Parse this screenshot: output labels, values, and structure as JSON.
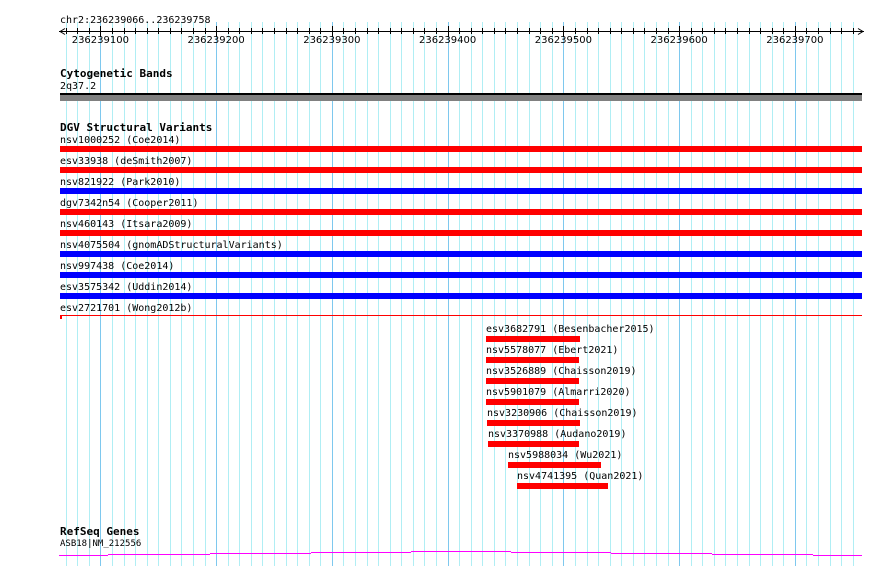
{
  "location": "chr2:236239066..236239758",
  "view": {
    "start": 236239066,
    "end": 236239758
  },
  "ruler": {
    "labels": [
      "236239100",
      "236239200",
      "236239300",
      "236239400",
      "236239500",
      "236239600",
      "236239700"
    ]
  },
  "tracks": {
    "cytoband": {
      "title": "Cytogenetic Bands",
      "band": "2q37.2",
      "color": "#808080"
    },
    "dgv": {
      "title": "DGV Structural Variants",
      "full_features": [
        {
          "label": "nsv1000252 (Coe2014)",
          "color": "#ff0000"
        },
        {
          "label": "esv33938 (deSmith2007)",
          "color": "#ff0000"
        },
        {
          "label": "nsv821922 (Park2010)",
          "color": "#0000ff"
        },
        {
          "label": "dgv7342n54 (Cooper2011)",
          "color": "#ff0000"
        },
        {
          "label": "nsv460143 (Itsara2009)",
          "color": "#ff0000"
        },
        {
          "label": "nsv4075504 (gnomADStructuralVariants)",
          "color": "#0000ff"
        },
        {
          "label": "nsv997438 (Coe2014)",
          "color": "#0000ff"
        },
        {
          "label": "esv3575342 (Uddin2014)",
          "color": "#0000ff"
        },
        {
          "label": "esv2721701 (Wong2012b)",
          "color": "#ff0000"
        }
      ],
      "local_features": [
        {
          "label": "esv3682791 (Besenbacher2015)",
          "start": 236239433,
          "end": 236239514,
          "color": "#ff0000"
        },
        {
          "label": "nsv5578077 (Ebert2021)",
          "start": 236239433,
          "end": 236239513,
          "color": "#ff0000"
        },
        {
          "label": "nsv3526889 (Chaisson2019)",
          "start": 236239433,
          "end": 236239513,
          "color": "#ff0000"
        },
        {
          "label": "nsv5901079 (Almarri2020)",
          "start": 236239433,
          "end": 236239513,
          "color": "#ff0000"
        },
        {
          "label": "nsv3230906 (Chaisson2019)",
          "start": 236239434,
          "end": 236239514,
          "color": "#ff0000"
        },
        {
          "label": "nsv3370988 (Audano2019)",
          "start": 236239435,
          "end": 236239514,
          "color": "#ff0000"
        },
        {
          "label": "nsv5988034 (Wu2021)",
          "start": 236239452,
          "end": 236239532,
          "color": "#ff0000"
        },
        {
          "label": "nsv4741395 (Quan2021)",
          "start": 236239460,
          "end": 236239539,
          "color": "#ff0000"
        }
      ]
    },
    "refseq": {
      "title": "RefSeq Genes",
      "gene": "ASB18|NM_212556",
      "color": "#ff00ff"
    }
  }
}
